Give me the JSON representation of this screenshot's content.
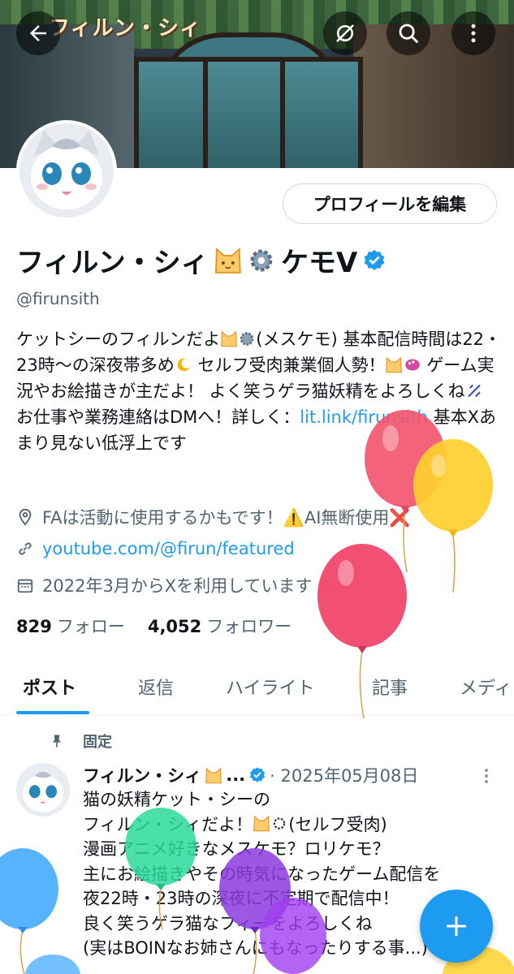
{
  "banner": {
    "logo_text": "フィルン・シィ"
  },
  "header": {
    "back_icon": "arrow-left-icon",
    "icons": [
      "offline-sync-icon",
      "search-icon",
      "more-vertical-icon"
    ]
  },
  "profile": {
    "edit_button": "プロフィールを編集",
    "name": "フィルン・シィ",
    "name_suffix": "ケモV",
    "handle": "@firunsith",
    "bio_1": "ケットシーのフィルンだよ",
    "bio_2": "(メスケモ) 基本配信時間は22・23時〜の深夜帯多め",
    "bio_3": " セルフ受肉兼業個人勢！",
    "bio_4": " ゲーム実況やお絵描きが主だよ！ よく笑うゲラ猫妖精をよろしくね",
    "bio_5": " お仕事や業務連絡はDMへ！詳しく：",
    "bio_link": "lit.link/firunsith",
    "bio_6": " 基本Xあまり見ない低浮上です",
    "location": "FAは活動に使用するかもです！⚠️AI無断使用❌",
    "website": "youtube.com/@firun/featured",
    "joined": "2022年3月からXを利用しています",
    "following_count": "829",
    "following_label": "フォロー",
    "followers_count": "4,052",
    "followers_label": "フォロワー"
  },
  "tabs": [
    "ポスト",
    "返信",
    "ハイライト",
    "記事",
    "メディア"
  ],
  "post": {
    "pinned_label": "固定",
    "author": "フィルン・シィ",
    "author_ellipsis": "...",
    "date": "· 2025年05月08日",
    "line_1": "猫の妖精ケット・シーの",
    "line_2": "フィルン・シィだよ！",
    "line_2b": "(セルフ受肉)",
    "line_3": "漫画アニメ好きなメスケモ？ロリケモ？",
    "line_4": "主にお絵描きやその時気になったゲーム配信を",
    "line_5": "夜22時・23時の深夜に不定期で配信中！",
    "line_6": "良く笑うゲラ猫なフィーをよろしくね",
    "line_7": "(実はBOINなお姉さんにもなったりする事...)"
  },
  "fab": {
    "label": "+"
  },
  "colors": {
    "accent": "#1d9bf0",
    "text": "#0f1419",
    "muted": "#536471"
  }
}
